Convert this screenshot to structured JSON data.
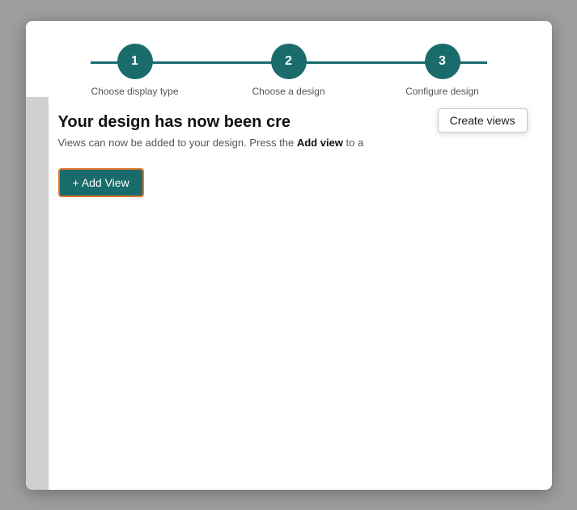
{
  "stepper": {
    "steps": [
      {
        "number": "1",
        "label": "Choose display type"
      },
      {
        "number": "2",
        "label": "Choose a design"
      },
      {
        "number": "3",
        "label": "Configure design"
      }
    ]
  },
  "tooltip": {
    "label": "Create views"
  },
  "content": {
    "title": "Your design has now been cre",
    "subtitle_prefix": "Views can now be added to your design. Press the ",
    "subtitle_bold": "Add view",
    "subtitle_suffix": " to a"
  },
  "buttons": {
    "add_view": "+ Add View"
  }
}
